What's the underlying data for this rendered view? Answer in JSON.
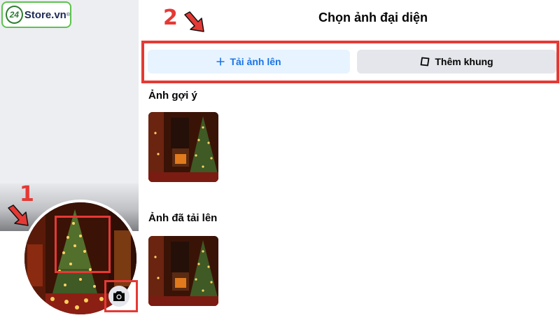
{
  "logo": {
    "badge": "24",
    "name": "Store.vn",
    "reg": "®"
  },
  "annotations": {
    "step_1": "1",
    "step_2": "2"
  },
  "dialog": {
    "title": "Chọn ảnh đại diện",
    "upload_button": "Tải ảnh lên",
    "frame_button": "Thêm khung"
  },
  "sections": {
    "suggested": "Ảnh gợi ý",
    "uploaded": "Ảnh đã tải lên"
  },
  "icons": {
    "upload": "plus-icon",
    "frame": "frame-icon",
    "camera": "camera-icon",
    "arrows": "red-arrow-icon"
  },
  "colors": {
    "highlight": "#e53935",
    "primary_blue": "#1b74e4",
    "upload_bg": "#e7f3ff",
    "secondary_bg": "#e4e6eb"
  }
}
